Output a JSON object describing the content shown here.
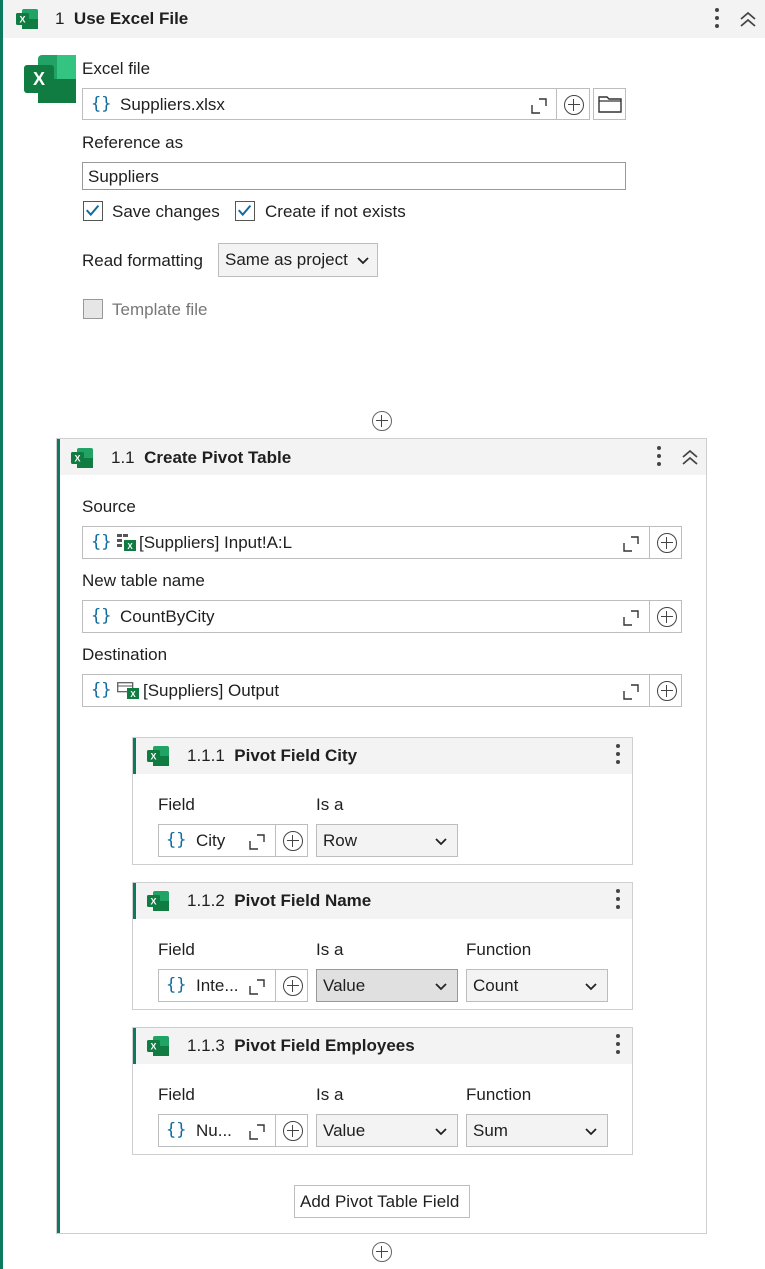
{
  "use_excel": {
    "number": "1",
    "title": "Use Excel File",
    "excel_file_label": "Excel file",
    "excel_file_value": "Suppliers.xlsx",
    "reference_label": "Reference as",
    "reference_value": "Suppliers",
    "save_changes_label": "Save changes",
    "save_changes_checked": true,
    "create_if_not_exists_label": "Create if not exists",
    "create_if_not_exists_checked": true,
    "read_formatting_label": "Read formatting",
    "read_formatting_value": "Same as project",
    "template_file_label": "Template file",
    "template_file_checked": false
  },
  "pivot_table": {
    "number": "1.1",
    "title": "Create Pivot Table",
    "source_label": "Source",
    "source_value": "[Suppliers] Input!A:L",
    "new_table_label": "New table name",
    "new_table_value": "CountByCity",
    "destination_label": "Destination",
    "destination_value": "[Suppliers] Output",
    "add_field_button": "Add Pivot Table Field"
  },
  "pivot_fields": [
    {
      "number": "1.1.1",
      "title": "Pivot Field City",
      "field_label": "Field",
      "field_value": "City",
      "is_a_label": "Is a",
      "is_a_value": "Row"
    },
    {
      "number": "1.1.2",
      "title": "Pivot Field Name",
      "field_label": "Field",
      "field_value": "Inte...",
      "is_a_label": "Is a",
      "is_a_value": "Value",
      "function_label": "Function",
      "function_value": "Count"
    },
    {
      "number": "1.1.3",
      "title": "Pivot Field Employees",
      "field_label": "Field",
      "field_value": "Nu...",
      "is_a_label": "Is a",
      "is_a_value": "Value",
      "function_label": "Function",
      "function_value": "Sum"
    }
  ],
  "colors": {
    "accent": "#0d7a5f",
    "excel_green": "#107c41",
    "brace_blue": "#0e6b9e",
    "header_bg": "#f3f3f3"
  },
  "icons": [
    "excel-icon",
    "kebab-menu-icon",
    "collapse-icon",
    "expand-icon",
    "add-circle-icon",
    "folder-icon",
    "checkbox-icon",
    "chevron-down-icon",
    "range-icon"
  ]
}
